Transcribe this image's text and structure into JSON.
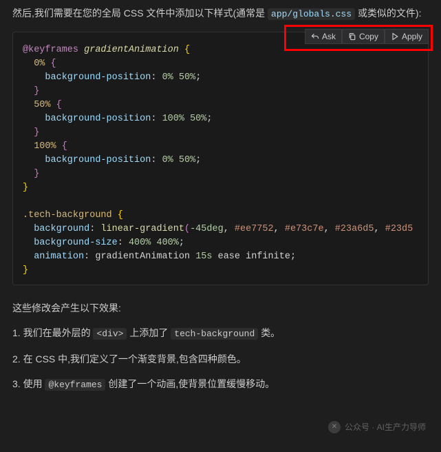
{
  "intro": {
    "part1": "然后,我们需要在您的全局 CSS 文件中添加以下样式(通常是 ",
    "code": "app/globals.css",
    "part2": " 或类似的文件):"
  },
  "toolbar": {
    "ask": "Ask",
    "copy": "Copy",
    "apply": "Apply"
  },
  "code": {
    "l1_at": "@keyframes",
    "l1_name": "gradientAnimation",
    "pct0": "0%",
    "pct50": "50%",
    "pct100": "100%",
    "bgpos": "background-position",
    "val0": "0%",
    "val50": "50%",
    "val100": "100%",
    "selector": ".tech-background",
    "prop_bg": "background",
    "func_lg": "linear-gradient",
    "deg": "-45deg",
    "c1": "#ee7752",
    "c2": "#e73c7e",
    "c3": "#23a6d5",
    "c4": "#23d5",
    "prop_bgs": "background-size",
    "bgs_v1": "400%",
    "bgs_v2": "400%",
    "prop_anim": "animation",
    "anim_name": "gradientAnimation",
    "anim_dur": "15s",
    "anim_ease": "ease",
    "anim_inf": "infinite"
  },
  "outro": {
    "heading": "这些修改会产生以下效果:",
    "item1_pre": "1. 我们在最外层的 ",
    "item1_code": "<div>",
    "item1_mid": " 上添加了 ",
    "item1_code2": "tech-background",
    "item1_post": " 类。",
    "item2": "2. 在 CSS 中,我们定义了一个渐变背景,包含四种颜色。",
    "item3_pre": "3. 使用 ",
    "item3_code": "@keyframes",
    "item3_post": " 创建了一个动画,使背景位置缓慢移动。"
  },
  "watermark": {
    "label": "公众号 · AI生产力导师"
  }
}
